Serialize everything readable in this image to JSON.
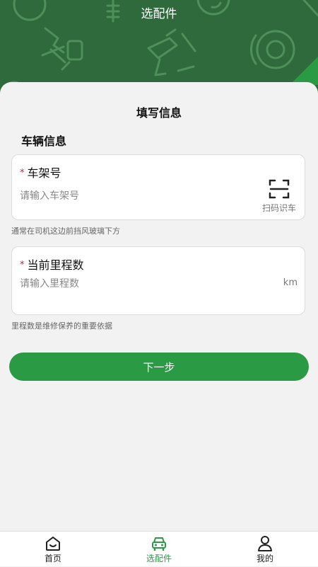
{
  "header": {
    "title": "选配件"
  },
  "form": {
    "title": "填写信息",
    "section_title": "车辆信息",
    "vin": {
      "required_mark": "*",
      "label": "车架号",
      "value": "",
      "placeholder": "请输入车架号",
      "scan_label": "扫码识车",
      "hint": "通常在司机这边前挡风玻璃下方"
    },
    "mileage": {
      "required_mark": "*",
      "label": "当前里程数",
      "value": "",
      "placeholder": "请输入里程数",
      "unit": "km",
      "hint": "里程数是维修保养的重要依据"
    },
    "next_label": "下一步"
  },
  "tabbar": {
    "active_index": 1,
    "items": [
      {
        "label": "首页",
        "icon": "home-icon"
      },
      {
        "label": "选配件",
        "icon": "car-icon"
      },
      {
        "label": "我的",
        "icon": "user-icon"
      }
    ]
  },
  "colors": {
    "header_bg": "#2f6a3c",
    "accent": "#2b9a44",
    "required": "#e02020"
  }
}
